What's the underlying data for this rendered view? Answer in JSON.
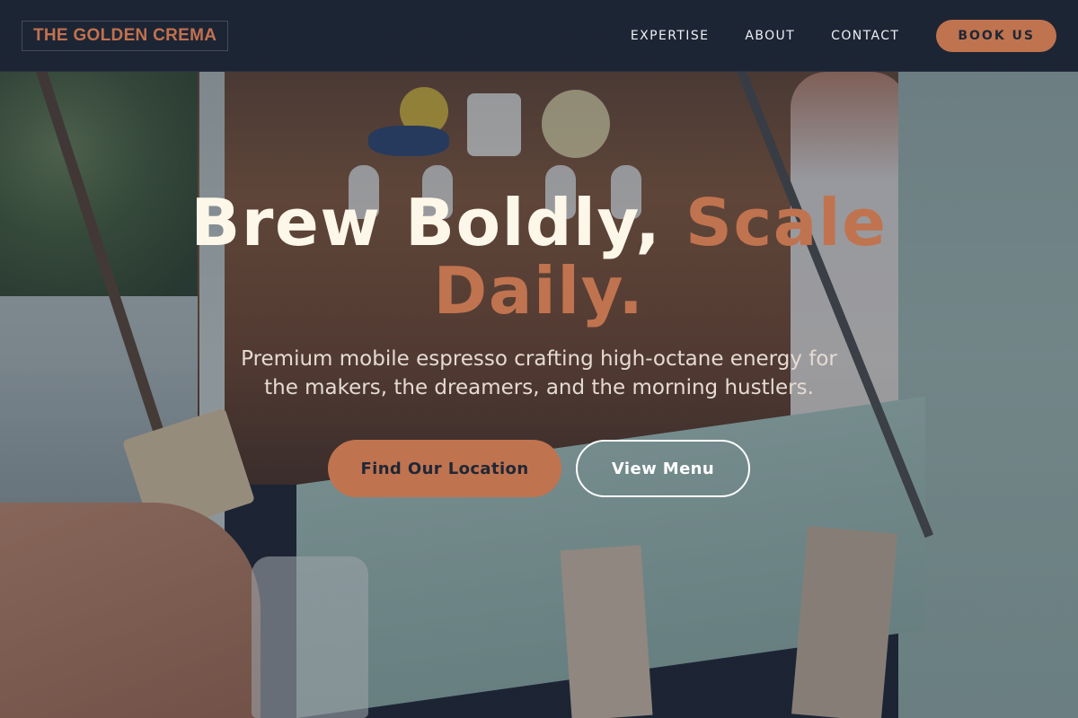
{
  "brand": {
    "name": "THE GOLDEN CREMA"
  },
  "nav": {
    "links": [
      "EXPERTISE",
      "ABOUT",
      "CONTACT"
    ],
    "cta": "BOOK US"
  },
  "hero": {
    "headline_part1": "Brew Boldly, ",
    "headline_accent": "Scale Daily.",
    "subheadline": "Premium mobile espresso crafting high-octane energy for the makers, the dreamers, and the morning hustlers.",
    "primary_cta": "Find Our Location",
    "secondary_cta": "View Menu"
  },
  "colors": {
    "accent": "#c0734f",
    "navbar": "#1d2535",
    "headline": "#fdf7ea"
  }
}
